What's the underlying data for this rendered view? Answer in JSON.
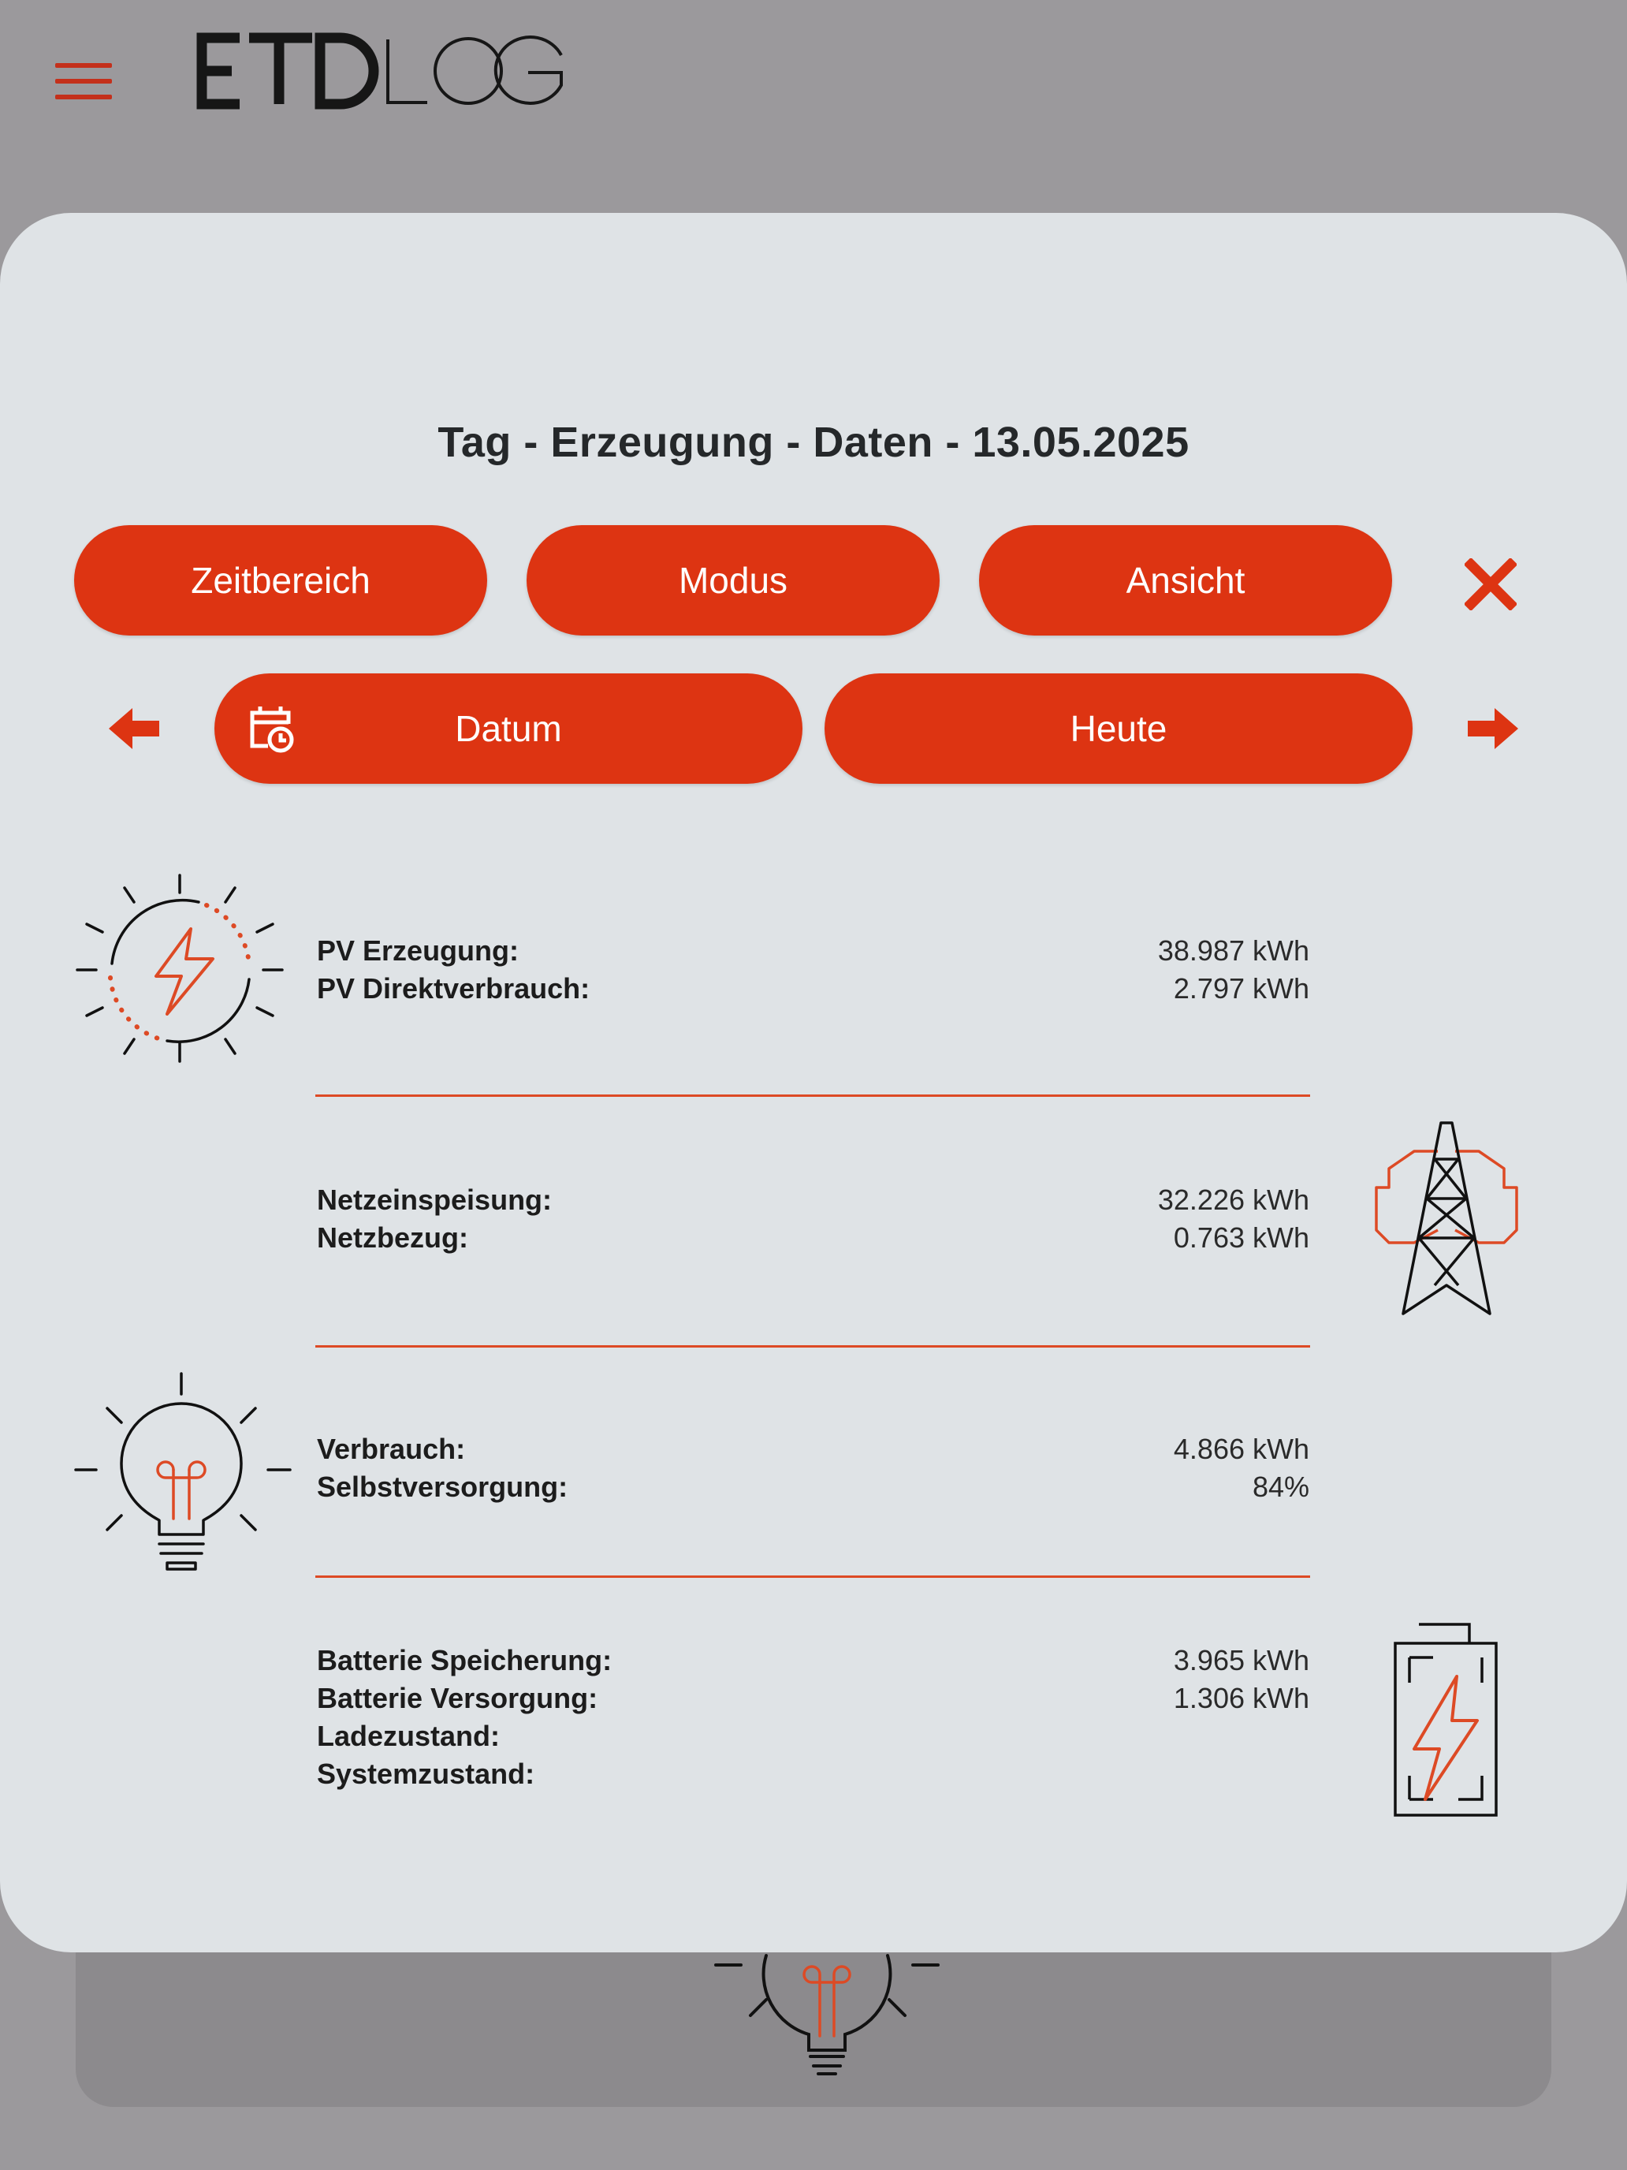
{
  "header": {
    "logo_text": "ETDLOG"
  },
  "dialog": {
    "title": "Tag - Erzeugung - Daten - 13.05.2025",
    "buttons": {
      "zeitbereich": "Zeitbereich",
      "modus": "Modus",
      "ansicht": "Ansicht",
      "datum": "Datum",
      "heute": "Heute"
    }
  },
  "sections": {
    "pv": {
      "rows": [
        {
          "label": "PV Erzeugung:",
          "value": "38.987 kWh"
        },
        {
          "label": "PV Direktverbrauch:",
          "value": "2.797 kWh"
        }
      ]
    },
    "grid": {
      "rows": [
        {
          "label": "Netzeinspeisung:",
          "value": "32.226 kWh"
        },
        {
          "label": "Netzbezug:",
          "value": "0.763 kWh"
        }
      ]
    },
    "consumption": {
      "rows": [
        {
          "label": "Verbrauch:",
          "value": "4.866 kWh"
        },
        {
          "label": "Selbstversorgung:",
          "value": "84%"
        }
      ]
    },
    "battery": {
      "rows": [
        {
          "label": "Batterie Speicherung:",
          "value": "3.965 kWh"
        },
        {
          "label": "Batterie Versorgung:",
          "value": "1.306 kWh"
        },
        {
          "label": "Ladezustand:",
          "value": ""
        },
        {
          "label": "Systemzustand:",
          "value": ""
        }
      ]
    }
  },
  "icons": {
    "menu": "hamburger-icon",
    "close": "close-icon",
    "prev": "arrow-left-icon",
    "next": "arrow-right-icon",
    "calendar": "calendar-clock-icon",
    "pv": "sun-bolt-icon",
    "grid": "power-tower-icon",
    "consumption": "light-bulb-icon",
    "battery": "battery-bolt-icon"
  },
  "colors": {
    "accent": "#dd3412",
    "panel": "#dfe3e6",
    "backdrop": "#9b999c"
  }
}
